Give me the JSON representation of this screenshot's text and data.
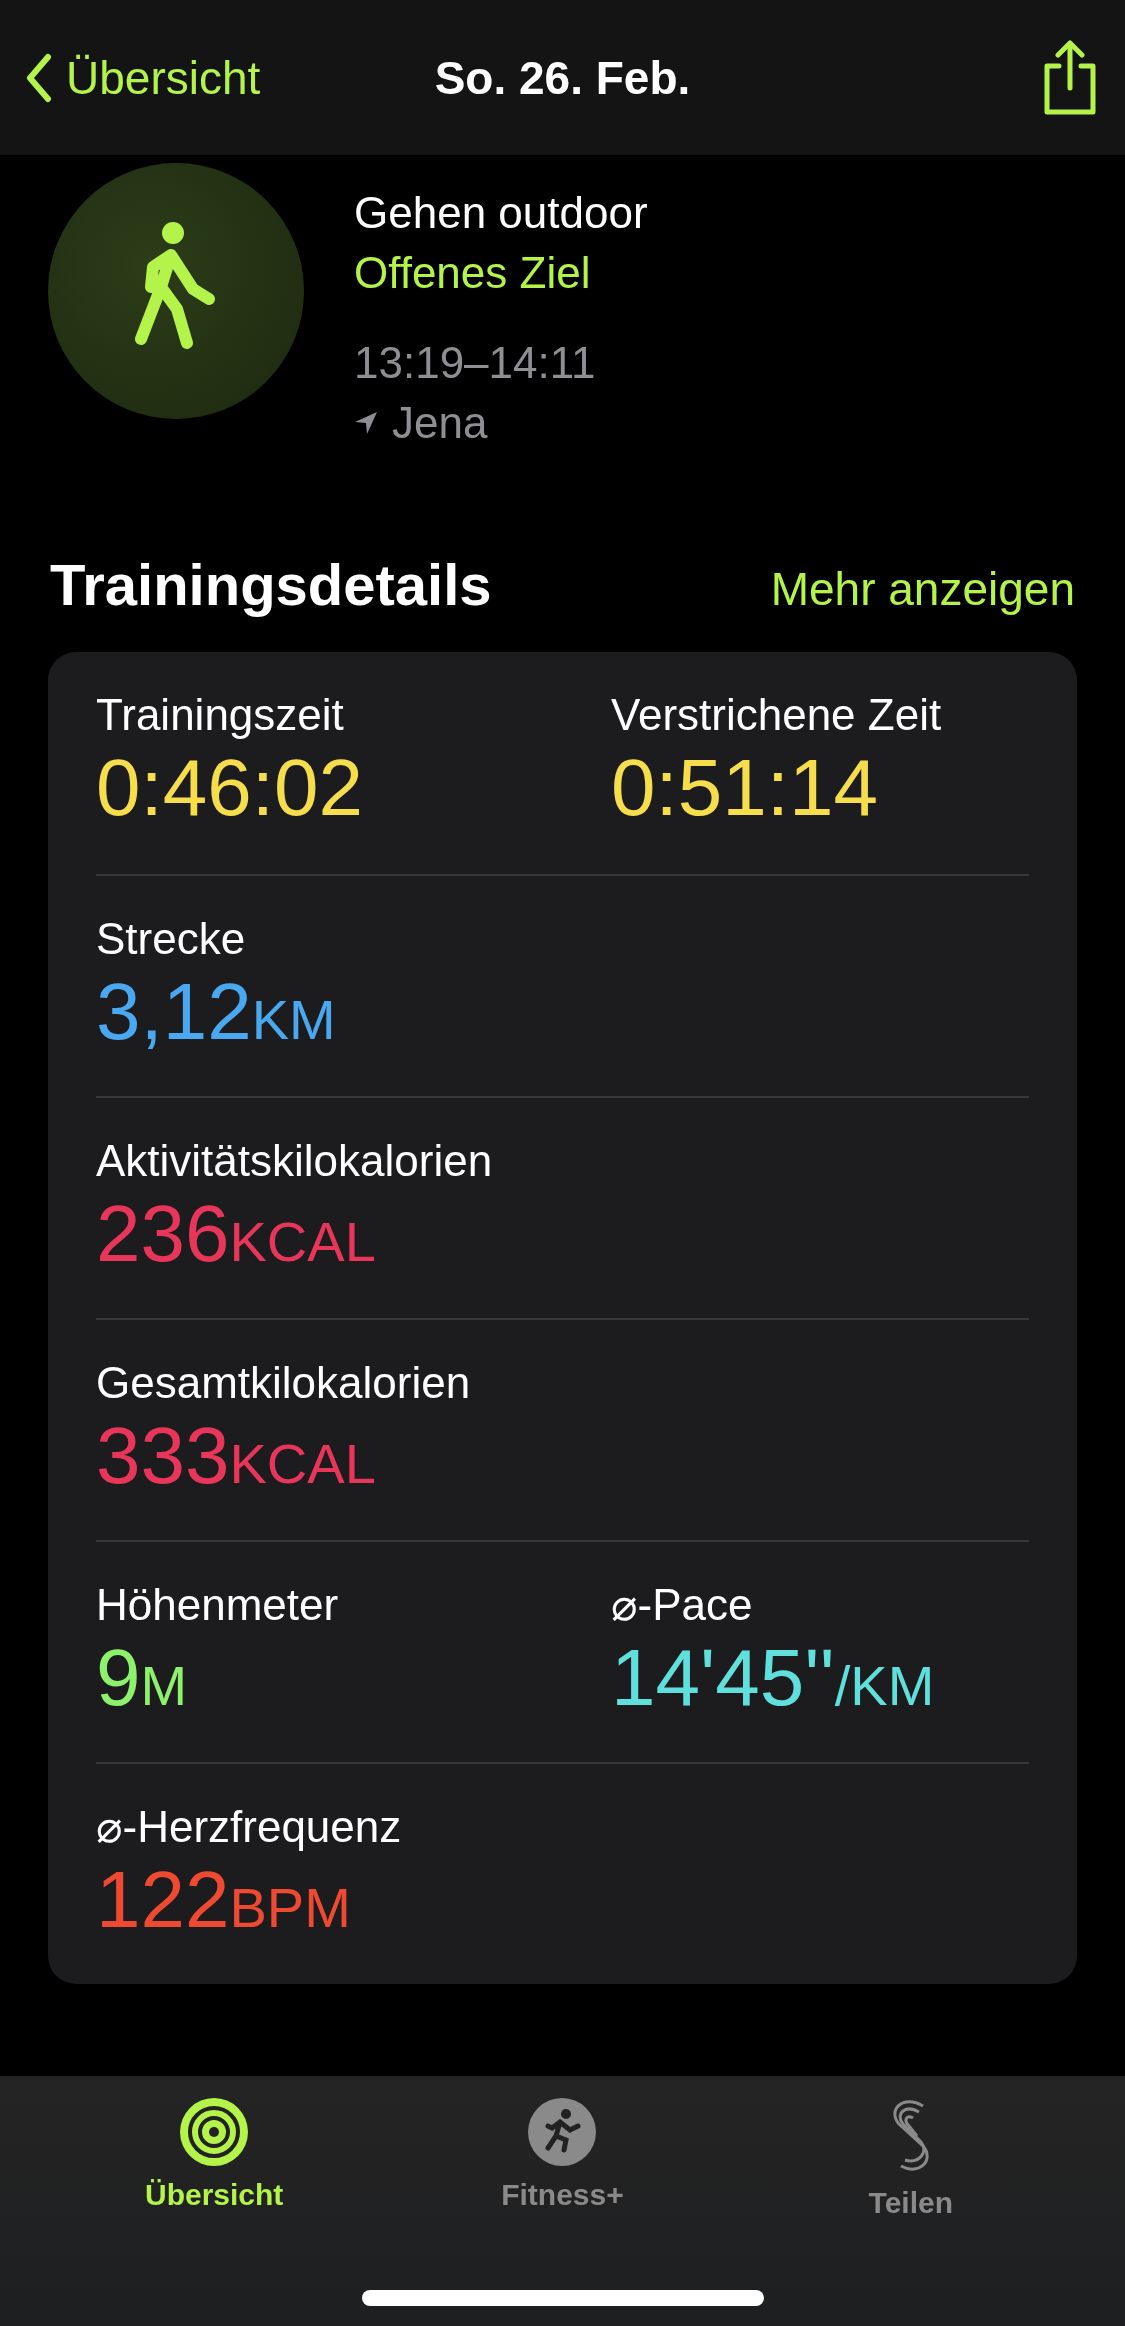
{
  "nav": {
    "back": "Übersicht",
    "title": "So. 26. Feb."
  },
  "workout": {
    "name": "Gehen outdoor",
    "goal": "Offenes Ziel",
    "time": "13:19–14:11",
    "location": "Jena"
  },
  "section": {
    "title": "Trainingsdetails",
    "link": "Mehr anzeigen"
  },
  "rows": [
    {
      "metrics": [
        {
          "label": "Trainingszeit",
          "value": "0:46:02",
          "color": "#f5dd4b"
        },
        {
          "label": "Verstrichene Zeit",
          "value": "0:51:14",
          "color": "#f5dd4b"
        }
      ]
    },
    {
      "metrics": [
        {
          "label": "Strecke",
          "value": "3,12",
          "unit": "KM",
          "color": "#4aa8f0"
        }
      ]
    },
    {
      "metrics": [
        {
          "label": "Aktivitätskilokalorien",
          "value": "236",
          "unit": "KCAL",
          "color": "#e8365a"
        }
      ]
    },
    {
      "metrics": [
        {
          "label": "Gesamtkilokalorien",
          "value": "333",
          "unit": "KCAL",
          "color": "#e8365a"
        }
      ]
    },
    {
      "metrics": [
        {
          "label": "Höhenmeter",
          "value": "9",
          "unit": "M",
          "color": "#8ef16c"
        },
        {
          "label": "⌀-Pace",
          "value": "14'45''",
          "unit": "/KM",
          "color": "#5fe0dc"
        }
      ]
    },
    {
      "metrics": [
        {
          "label": "⌀-Herzfrequenz",
          "value": "122",
          "unit": "BPM",
          "color": "#ee4a32"
        }
      ]
    }
  ],
  "tabs": [
    {
      "label": "Übersicht",
      "kind": "rings",
      "selected": true
    },
    {
      "label": "Fitness+",
      "kind": "fitness",
      "selected": false
    },
    {
      "label": "Teilen",
      "kind": "sharing",
      "selected": false
    }
  ]
}
